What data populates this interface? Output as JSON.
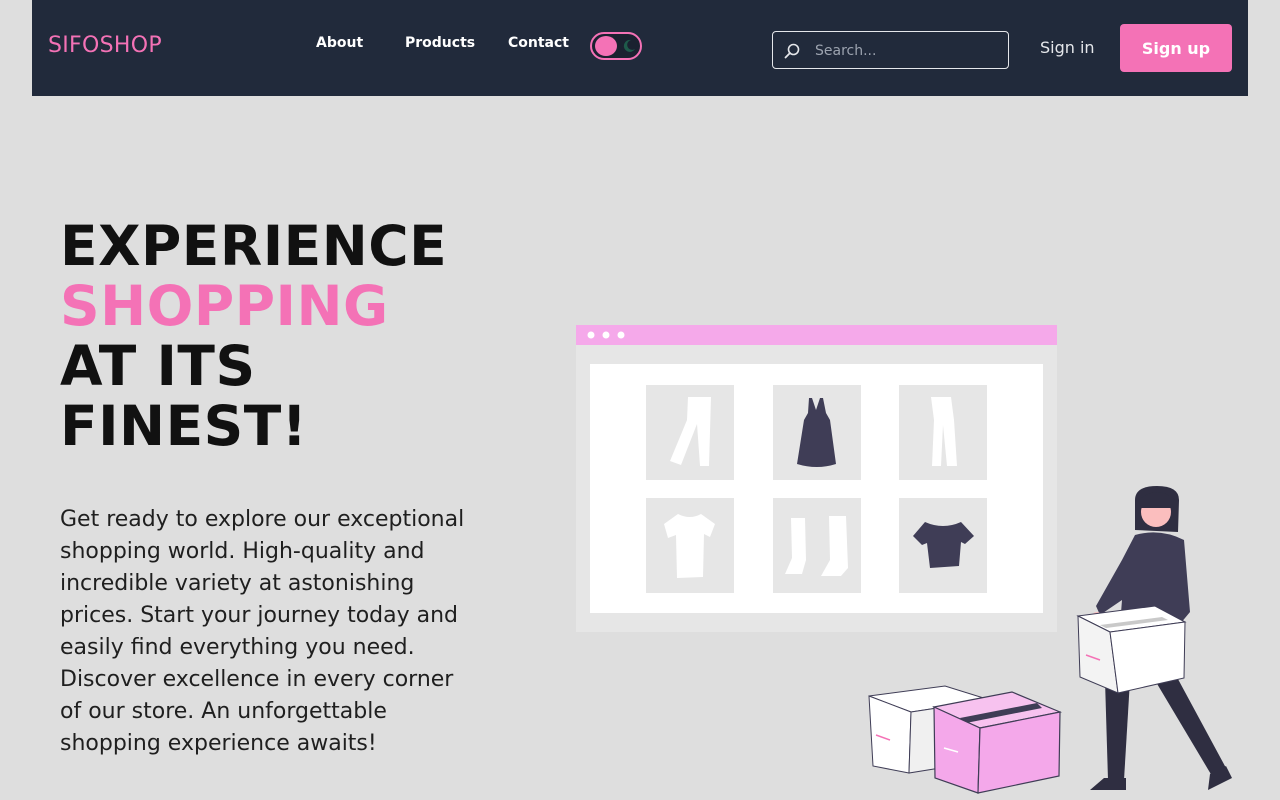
{
  "nav": {
    "brand": "SIFOSHOP",
    "links": [
      {
        "label": "About"
      },
      {
        "label": "Products"
      },
      {
        "label": "Contact"
      }
    ],
    "search": {
      "placeholder": "Search...",
      "value": ""
    },
    "signin_label": "Sign in",
    "signup_label": "Sign up",
    "theme_toggle": {
      "icon": "moon-icon",
      "state": "light"
    }
  },
  "hero": {
    "title_line_1": "EXPERIENCE",
    "title_line_2": "SHOPPING",
    "title_line_3": "AT ITS",
    "title_line_4": "FINEST!",
    "description": "Get ready to explore our exceptional shopping world. High-quality and incredible variety at astonishing prices. Start your journey today and easily find everything you need. Discover excellence in every corner of our store. An unforgettable shopping experience awaits!"
  },
  "illustration": {
    "products": [
      "pants-icon",
      "dress-icon",
      "trousers-icon",
      "tshirt-icon",
      "boots-icon",
      "crop-top-icon"
    ]
  },
  "colors": {
    "accent": "#f472b6",
    "nav_bg": "#212a3b",
    "page_bg": "#dedede",
    "illustration_dark": "#3f3d56",
    "box_pink": "#f4a8ea"
  }
}
